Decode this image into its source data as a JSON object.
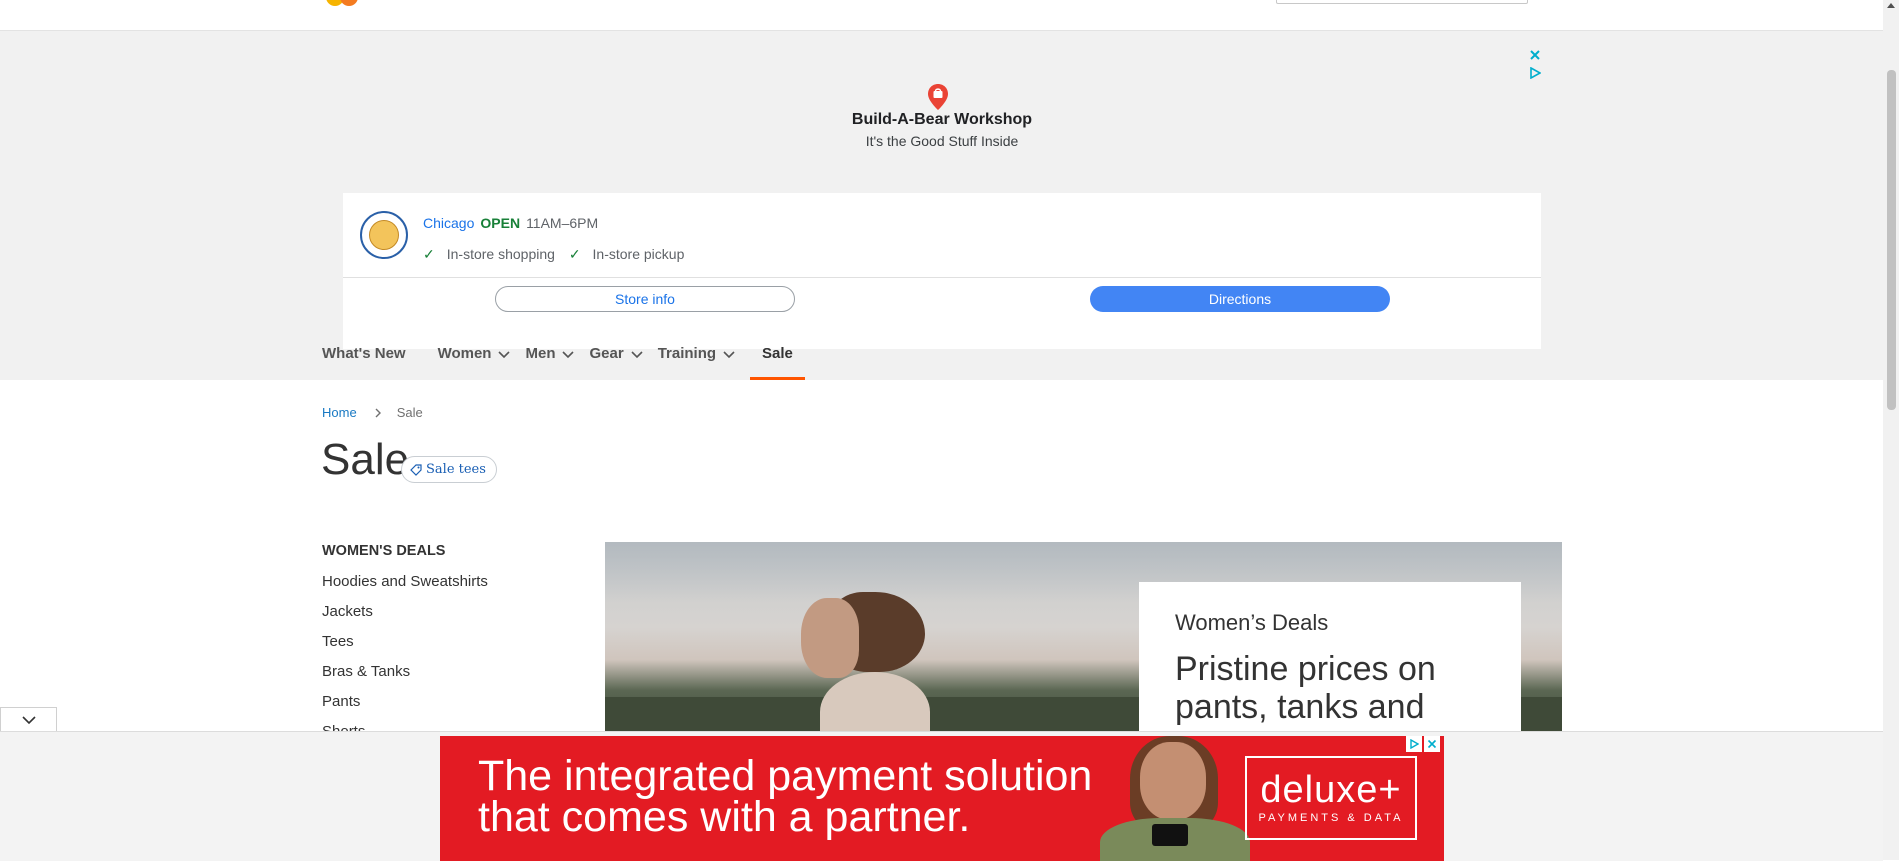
{
  "ad": {
    "business_name": "Build-A-Bear Workshop",
    "tagline": "It's the Good Stuff Inside",
    "store": {
      "city": "Chicago",
      "status": "OPEN",
      "hours": "11AM–6PM",
      "features": [
        "In-store shopping",
        "In-store pickup"
      ],
      "store_info_label": "Store info",
      "directions_label": "Directions"
    }
  },
  "nav": {
    "items": [
      {
        "label": "What's New",
        "has_dropdown": false
      },
      {
        "label": "Women",
        "has_dropdown": true
      },
      {
        "label": "Men",
        "has_dropdown": true
      },
      {
        "label": "Gear",
        "has_dropdown": true
      },
      {
        "label": "Training",
        "has_dropdown": true
      },
      {
        "label": "Sale",
        "has_dropdown": false,
        "active": true
      }
    ]
  },
  "breadcrumb": {
    "home": "Home",
    "current": "Sale"
  },
  "page": {
    "title": "Sale",
    "tag_label": "Sale tees"
  },
  "sidebar": {
    "title": "WOMEN'S DEALS",
    "items": [
      "Hoodies and Sweatshirts",
      "Jackets",
      "Tees",
      "Bras & Tanks",
      "Pants",
      "Shorts"
    ]
  },
  "hero": {
    "eyebrow": "Women’s Deals",
    "headline": "Pristine prices on pants, tanks and"
  },
  "banner_ad": {
    "line1": "The integrated payment solution",
    "line2": "that comes with a partner.",
    "brand": "deluxe+",
    "brand_sub": "PAYMENTS & DATA"
  },
  "colors": {
    "accent": "#ff5501",
    "link": "#1979c3",
    "maps_blue": "#4285f4",
    "open_green": "#188038",
    "banner_red": "#e31b23"
  }
}
